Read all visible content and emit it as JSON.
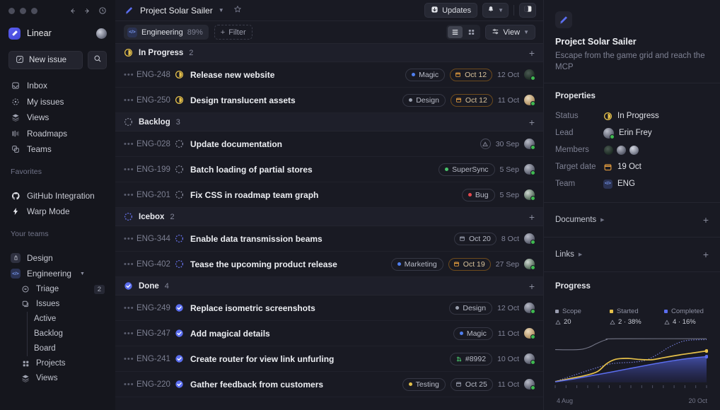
{
  "window": {
    "traffic_lights": [
      "close",
      "minimize",
      "maximize"
    ],
    "nav_back": "back-arrow",
    "nav_forward": "forward-arrow",
    "history": "history-clock"
  },
  "sidebar": {
    "brand": "Linear",
    "new_issue_label": "New issue",
    "search_icon": "search-icon",
    "nav": [
      {
        "label": "Inbox",
        "icon": "inbox-icon"
      },
      {
        "label": "My issues",
        "icon": "my-issues-icon"
      },
      {
        "label": "Views",
        "icon": "views-icon"
      },
      {
        "label": "Roadmaps",
        "icon": "roadmaps-icon"
      },
      {
        "label": "Teams",
        "icon": "teams-icon"
      }
    ],
    "favorites_label": "Favorites",
    "favorites": [
      {
        "label": "GitHub Integration",
        "icon": "github-icon"
      },
      {
        "label": "Warp Mode",
        "icon": "bolt-icon"
      }
    ],
    "teams_label": "Your teams",
    "teams": [
      {
        "label": "Design",
        "badge": "D"
      },
      {
        "label": "Engineering",
        "badge": "</>"
      }
    ],
    "eng_children": [
      {
        "label": "Triage",
        "count": "2",
        "icon": "triage-icon"
      },
      {
        "label": "Issues",
        "count": "",
        "icon": "issues-icon"
      }
    ],
    "issue_leaves": [
      "Active",
      "Backlog",
      "Board"
    ],
    "eng_tail": [
      {
        "label": "Projects",
        "icon": "projects-icon"
      },
      {
        "label": "Views",
        "icon": "views-icon"
      }
    ]
  },
  "topbar": {
    "project_title": "Project Solar Sailer",
    "star_icon": "star-icon",
    "updates_label": "Updates",
    "notifications_icon": "bell-icon",
    "panel_toggle_icon": "right-panel-icon"
  },
  "filterbar": {
    "team_pill": "Engineering",
    "team_pill_pct": "89%",
    "filter_label": "Filter",
    "view_label": "View",
    "list_view_icon": "list-view-icon",
    "board_view_icon": "grid-view-icon",
    "active_view": "list"
  },
  "groups": [
    {
      "name": "In Progress",
      "count": "2",
      "status": "in-progress",
      "rows": [
        {
          "id": "ENG-248",
          "title": "Release new website",
          "status": "in-progress",
          "labels": [
            {
              "text": "Magic",
              "color": "#4f7ff0"
            }
          ],
          "date_chip": {
            "text": "Oct 12",
            "style": "warn"
          },
          "date": "12 Oct",
          "avatar": "dark"
        },
        {
          "id": "ENG-250",
          "title": "Design translucent assets",
          "status": "in-progress",
          "labels": [
            {
              "text": "Design",
              "color": "#9aa0ae"
            }
          ],
          "date_chip": {
            "text": "Oct 12",
            "style": "warn"
          },
          "date": "11 Oct",
          "avatar": "warm"
        }
      ]
    },
    {
      "name": "Backlog",
      "count": "3",
      "status": "backlog",
      "rows": [
        {
          "id": "ENG-028",
          "title": "Update documentation",
          "status": "backlog",
          "labels": [],
          "priority": "warning",
          "date": "30 Sep",
          "avatar": "mid"
        },
        {
          "id": "ENG-199",
          "title": "Batch loading of partial stores",
          "status": "backlog",
          "labels": [
            {
              "text": "SuperSync",
              "color": "#49c26a"
            }
          ],
          "date": "5 Sep",
          "avatar": "mid"
        },
        {
          "id": "ENG-201",
          "title": "Fix CSS in roadmap team graph",
          "status": "backlog",
          "labels": [
            {
              "text": "Bug",
              "color": "#e5484d"
            }
          ],
          "date": "5 Sep",
          "avatar": "green"
        }
      ]
    },
    {
      "name": "Icebox",
      "count": "2",
      "status": "icebox",
      "rows": [
        {
          "id": "ENG-344",
          "title": "Enable data transmission beams",
          "status": "icebox",
          "labels": [],
          "date_chip": {
            "text": "Oct 20",
            "style": "plain"
          },
          "date": "8 Oct",
          "avatar": "mid"
        },
        {
          "id": "ENG-402",
          "title": "Tease the upcoming product release",
          "status": "icebox",
          "labels": [
            {
              "text": "Marketing",
              "color": "#4f7ff0"
            }
          ],
          "date_chip": {
            "text": "Oct 19",
            "style": "warn"
          },
          "date": "27 Sep",
          "avatar": "green"
        }
      ]
    },
    {
      "name": "Done",
      "count": "4",
      "status": "done",
      "rows": [
        {
          "id": "ENG-249",
          "title": "Replace isometric screenshots",
          "status": "done",
          "labels": [
            {
              "text": "Design",
              "color": "#9aa0ae"
            }
          ],
          "date": "12 Oct",
          "avatar": "mid"
        },
        {
          "id": "ENG-247",
          "title": "Add magical details",
          "status": "done",
          "labels": [
            {
              "text": "Magic",
              "color": "#4f7ff0"
            }
          ],
          "date": "11 Oct",
          "avatar": "warm"
        },
        {
          "id": "ENG-241",
          "title": "Create router for view link unfurling",
          "status": "done",
          "labels": [
            {
              "text": "#8992",
              "color": "#49c26a",
              "icon": "github-pr-icon"
            }
          ],
          "date": "10 Oct",
          "avatar": "mid"
        },
        {
          "id": "ENG-220",
          "title": "Gather feedback from customers",
          "status": "done",
          "labels": [
            {
              "text": "Testing",
              "color": "#e3c04a"
            }
          ],
          "date_chip": {
            "text": "Oct 25",
            "style": "plain"
          },
          "date": "11 Oct",
          "avatar": "mid"
        }
      ]
    }
  ],
  "rpanel": {
    "title": "Project Solar Sailer",
    "description": "Escape from the game grid and reach the MCP",
    "properties_title": "Properties",
    "properties": [
      {
        "label": "Status",
        "value": "In Progress",
        "icon": "in-progress-icon"
      },
      {
        "label": "Lead",
        "value": "Erin Frey",
        "icon": "avatar"
      },
      {
        "label": "Members",
        "value": "",
        "icon": "avatar-group"
      },
      {
        "label": "Target date",
        "value": "19 Oct",
        "icon": "calendar-icon"
      },
      {
        "label": "Team",
        "value": "ENG",
        "icon": "eng-badge"
      }
    ],
    "documents_label": "Documents",
    "links_label": "Links",
    "add_icon": "plus-icon",
    "progress_title": "Progress"
  },
  "chart_data": {
    "type": "area",
    "title": "Progress",
    "xlabel": "",
    "ylabel": "",
    "x_tick_labels": [
      "4 Aug",
      "20 Oct"
    ],
    "x_range": [
      "4 Aug",
      "20 Oct"
    ],
    "ylim": [
      0,
      22
    ],
    "grid": false,
    "legend_position": "top",
    "legend": [
      {
        "name": "Scope",
        "color": "#9a9db0",
        "value": "20",
        "delta_icon": "scope-icon"
      },
      {
        "name": "Started",
        "color": "#e5c04a",
        "value": "2",
        "pct": "38%",
        "label": "2 · 38%"
      },
      {
        "name": "Completed",
        "color": "#5b6ef0",
        "value": "4",
        "pct": "16%",
        "label": "4 · 16%"
      }
    ],
    "series": [
      {
        "name": "Scope",
        "color": "#9a9db0",
        "style": "line",
        "x": [
          0,
          15,
          22,
          28,
          34,
          40,
          100
        ],
        "values": [
          15,
          15,
          16,
          18,
          19.6,
          20,
          20
        ]
      },
      {
        "name": "Projection",
        "color": "#7c86e8",
        "style": "dotted",
        "x": [
          0,
          12,
          24,
          36,
          44,
          52,
          60,
          68,
          76,
          86,
          100
        ],
        "values": [
          0.4,
          3.2,
          6.0,
          8.4,
          9.0,
          9.3,
          10.2,
          13.0,
          16.4,
          19.1,
          19.6
        ]
      },
      {
        "name": "Started",
        "color": "#e5c04a",
        "style": "line",
        "x": [
          0,
          10,
          20,
          28,
          34,
          40,
          48,
          56,
          64,
          72,
          82,
          92,
          100
        ],
        "values": [
          0.4,
          1.8,
          3.2,
          5.0,
          8.6,
          10.6,
          11.0,
          10.5,
          10.4,
          11.4,
          12.6,
          13.6,
          14.4
        ]
      },
      {
        "name": "Completed",
        "color": "#5b6ef0",
        "style": "area",
        "x": [
          0,
          12,
          24,
          36,
          48,
          60,
          72,
          84,
          92,
          100
        ],
        "values": [
          0.3,
          1.6,
          3.1,
          4.6,
          6.2,
          7.8,
          9.3,
          10.6,
          11.3,
          11.8
        ]
      }
    ]
  }
}
